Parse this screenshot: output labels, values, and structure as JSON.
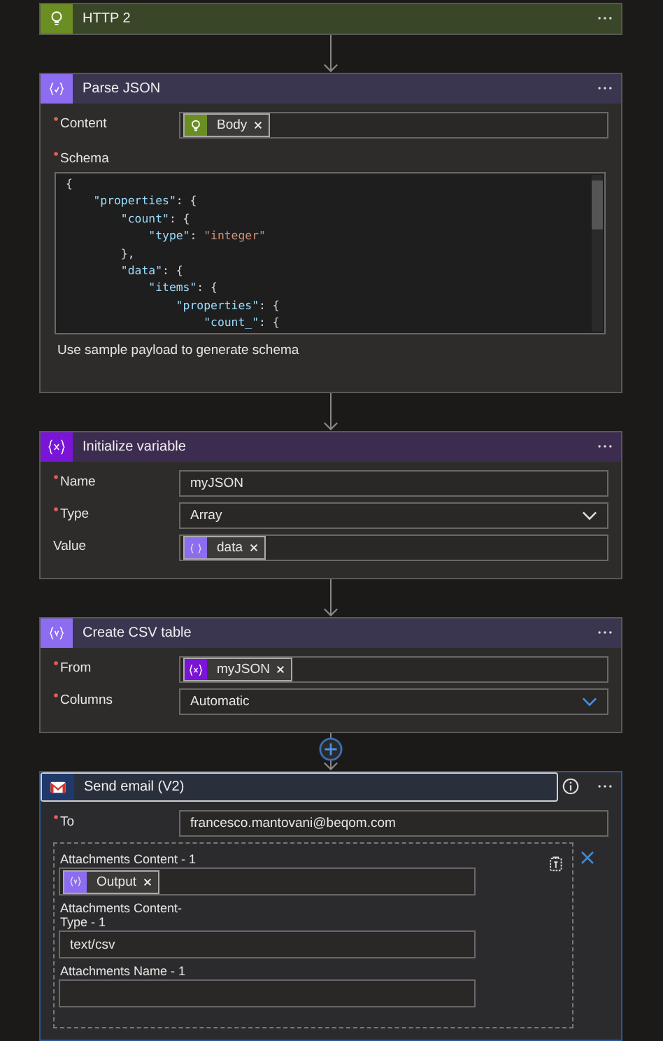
{
  "cards": [
    {
      "kind": "http",
      "title": "HTTP 2",
      "color": "#6b8e23",
      "selected": false
    },
    {
      "kind": "braces",
      "title": "Parse JSON",
      "color": "#8c6cf0",
      "selected": false,
      "plus_above": false,
      "fields": [
        {
          "label": "Content",
          "required": true,
          "kind": "tokens",
          "tokens": [
            {
              "text": "Body",
              "kind": "http",
              "color": "#6b8e23"
            }
          ]
        },
        {
          "label": "Schema",
          "required": true,
          "kind": "code",
          "lines": [
            [
              {
                "t": "{",
                "kind": "punct"
              }
            ],
            [
              {
                "t": "    \"properties\"",
                "kind": "key"
              },
              {
                "t": ": {",
                "kind": "punct"
              }
            ],
            [
              {
                "t": "        \"count\"",
                "kind": "key"
              },
              {
                "t": ": {",
                "kind": "punct"
              }
            ],
            [
              {
                "t": "            \"type\"",
                "kind": "key"
              },
              {
                "t": ": ",
                "kind": "punct"
              },
              {
                "t": "\"integer\"",
                "kind": "string"
              }
            ],
            [
              {
                "t": "        },",
                "kind": "punct"
              }
            ],
            [
              {
                "t": "        \"data\"",
                "kind": "key"
              },
              {
                "t": ": {",
                "kind": "punct"
              }
            ],
            [
              {
                "t": "            \"items\"",
                "kind": "key"
              },
              {
                "t": ": {",
                "kind": "punct"
              }
            ],
            [
              {
                "t": "                \"properties\"",
                "kind": "key"
              },
              {
                "t": ": {",
                "kind": "punct"
              }
            ],
            [
              {
                "t": "                    \"count_\"",
                "kind": "key"
              },
              {
                "t": ": {",
                "kind": "punct"
              }
            ]
          ]
        }
      ],
      "link": "Use sample payload to generate schema"
    },
    {
      "kind": "variable",
      "title": "Initialize variable",
      "color": "#7a14d6",
      "selected": false,
      "plus_above": false,
      "fields": [
        {
          "label": "Name",
          "required": true,
          "kind": "text",
          "value": "myJSON"
        },
        {
          "label": "Type",
          "required": true,
          "kind": "dropdown",
          "value": "Array",
          "focused": false
        },
        {
          "label": "Value",
          "kind": "tokens",
          "tokens": [
            {
              "text": "data",
              "kind": "braces",
              "color": "#8c6cf0"
            }
          ]
        }
      ]
    },
    {
      "kind": "table",
      "title": "Create CSV table",
      "color": "#8c6cf0",
      "selected": false,
      "plus_above": false,
      "fields": [
        {
          "label": "From",
          "required": true,
          "kind": "tokens",
          "tokens": [
            {
              "text": "myJSON",
              "kind": "variable",
              "color": "#7a14d6"
            }
          ]
        },
        {
          "label": "Columns",
          "required": true,
          "kind": "dropdown",
          "value": "Automatic",
          "focused": true
        }
      ]
    },
    {
      "kind": "mail",
      "title": "Send email (V2)",
      "color": "#1f3a6a",
      "selected": true,
      "plus_above": true,
      "fields": [
        {
          "label": "To",
          "required": true,
          "kind": "text",
          "value": "francesco.mantovani@beqom.com"
        }
      ],
      "attachments": [
        {
          "label": "Attachments Content - 1",
          "kind": "tokens",
          "tokens": [
            {
              "text": "Output",
              "kind": "table",
              "color": "#8c6cf0"
            }
          ]
        },
        {
          "label": "Attachments Content-Type - 1",
          "kind": "text",
          "value": "text/csv"
        },
        {
          "label": "Attachments Name - 1",
          "kind": "text"
        }
      ]
    }
  ]
}
